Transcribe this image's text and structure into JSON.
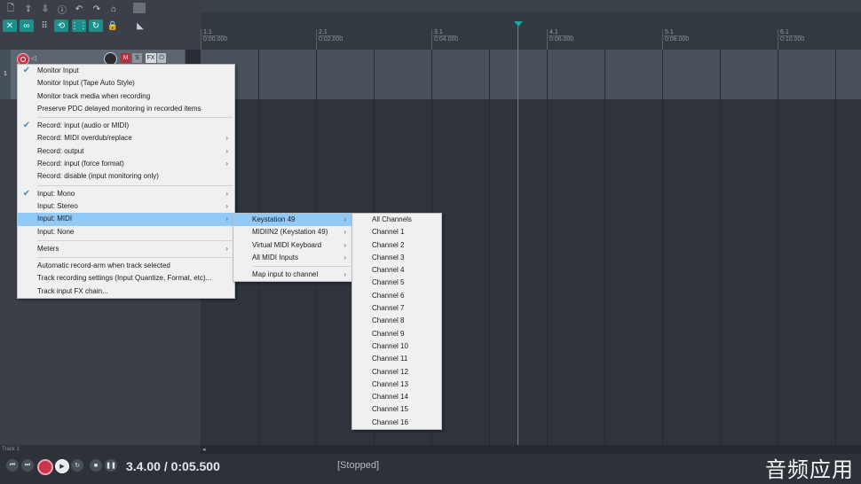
{
  "ruler": {
    "markers": [
      {
        "bar": "1.1",
        "time": "0:00.000"
      },
      {
        "bar": "2.1",
        "time": "0:02.000"
      },
      {
        "bar": "3.1",
        "time": "0:04.000"
      },
      {
        "bar": "4.1",
        "time": "0:06.000"
      },
      {
        "bar": "5.1",
        "time": "0:08.000"
      },
      {
        "bar": "6.1",
        "time": "0:10.000"
      }
    ]
  },
  "track": {
    "number": "1",
    "mute_label": "M",
    "solo_label": "S",
    "fx_label": "FX"
  },
  "menu_main": {
    "groups": [
      [
        {
          "label": "Monitor Input",
          "checked": true,
          "submenu": false
        },
        {
          "label": "Monitor Input (Tape Auto Style)",
          "checked": false,
          "submenu": false
        },
        {
          "label": "Monitor track media when recording",
          "checked": false,
          "submenu": false
        },
        {
          "label": "Preserve PDC delayed monitoring in recorded items",
          "checked": false,
          "submenu": false
        }
      ],
      [
        {
          "label": "Record: input (audio or MIDI)",
          "checked": true,
          "submenu": false
        },
        {
          "label": "Record: MIDI overdub/replace",
          "checked": false,
          "submenu": true
        },
        {
          "label": "Record: output",
          "checked": false,
          "submenu": true
        },
        {
          "label": "Record: input (force format)",
          "checked": false,
          "submenu": true
        },
        {
          "label": "Record: disable (input monitoring only)",
          "checked": false,
          "submenu": false
        }
      ],
      [
        {
          "label": "Input: Mono",
          "checked": true,
          "submenu": true
        },
        {
          "label": "Input: Stereo",
          "checked": false,
          "submenu": true
        },
        {
          "label": "Input: MIDI",
          "checked": false,
          "submenu": true,
          "highlighted": true
        },
        {
          "label": "Input: None",
          "checked": false,
          "submenu": false
        }
      ],
      [
        {
          "label": "Meters",
          "checked": false,
          "submenu": true
        }
      ],
      [
        {
          "label": "Automatic record-arm when track selected",
          "checked": false,
          "submenu": false
        },
        {
          "label": "Track recording settings (Input Quantize, Format, etc)...",
          "checked": false,
          "submenu": false
        },
        {
          "label": "Track input FX chain...",
          "checked": false,
          "submenu": false
        }
      ]
    ]
  },
  "menu_midi": {
    "groups": [
      [
        {
          "label": "Keystation 49",
          "submenu": true,
          "highlighted": true
        },
        {
          "label": "MIDIIN2 (Keystation 49)",
          "submenu": true
        },
        {
          "label": "Virtual MIDI Keyboard",
          "submenu": true
        },
        {
          "label": "All MIDI Inputs",
          "submenu": true
        }
      ],
      [
        {
          "label": "Map input to channel",
          "submenu": true
        }
      ]
    ]
  },
  "menu_channels": {
    "items": [
      "All Channels",
      "Channel 1",
      "Channel 2",
      "Channel 3",
      "Channel 4",
      "Channel 5",
      "Channel 6",
      "Channel 7",
      "Channel 8",
      "Channel 9",
      "Channel 10",
      "Channel 11",
      "Channel 12",
      "Channel 13",
      "Channel 14",
      "Channel 15",
      "Channel 16"
    ]
  },
  "transport": {
    "track_label": "Track 1",
    "time": "3.4.00 / 0:05.500",
    "status": "[Stopped]"
  },
  "watermark": "音频应用",
  "colors": {
    "accent_teal": "#1aa79e",
    "record_red": "#c9364b",
    "menu_highlight": "#91c9f7"
  }
}
